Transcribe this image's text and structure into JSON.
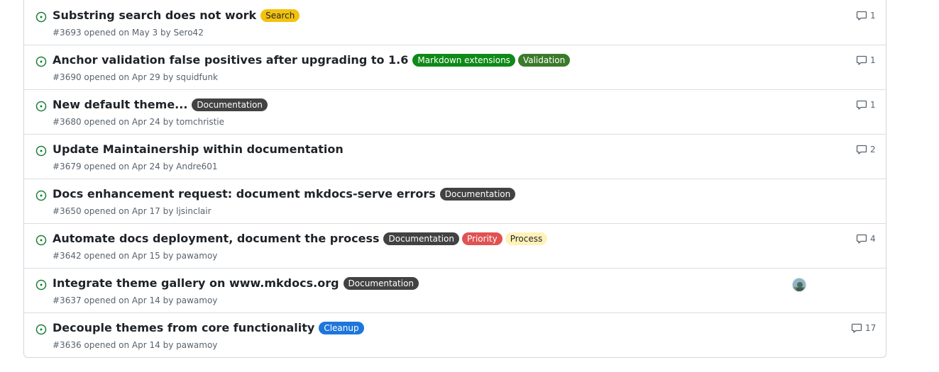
{
  "issues": [
    {
      "title": "Substring search does not work",
      "meta_prefix": "#3693 opened on May 3 by ",
      "author": "Sero42",
      "labels": [
        {
          "text": "Search",
          "bg": "#f4c20d",
          "fg": "#1f2328"
        }
      ],
      "comments": "1"
    },
    {
      "title": "Anchor validation false positives after upgrading to 1.6",
      "meta_prefix": "#3690 opened on Apr 29 by ",
      "author": "squidfunk",
      "labels": [
        {
          "text": "Markdown extensions",
          "bg": "#0e8a16",
          "fg": "#ffffff"
        },
        {
          "text": "Validation",
          "bg": "#3b7a2a",
          "fg": "#ffffff"
        }
      ],
      "comments": "1"
    },
    {
      "title": "New default theme...",
      "meta_prefix": "#3680 opened on Apr 24 by ",
      "author": "tomchristie",
      "labels": [
        {
          "text": "Documentation",
          "bg": "#424242",
          "fg": "#ffffff"
        }
      ],
      "comments": "1"
    },
    {
      "title": "Update Maintainership within documentation",
      "meta_prefix": "#3679 opened on Apr 24 by ",
      "author": "Andre601",
      "labels": [],
      "comments": "2"
    },
    {
      "title": "Docs enhancement request: document mkdocs-serve errors",
      "meta_prefix": "#3650 opened on Apr 17 by ",
      "author": "ljsinclair",
      "labels": [
        {
          "text": "Documentation",
          "bg": "#424242",
          "fg": "#ffffff"
        }
      ],
      "comments": ""
    },
    {
      "title": "Automate docs deployment, document the process",
      "meta_prefix": "#3642 opened on Apr 15 by ",
      "author": "pawamoy",
      "labels": [
        {
          "text": "Documentation",
          "bg": "#424242",
          "fg": "#ffffff"
        },
        {
          "text": "Priority",
          "bg": "#e05252",
          "fg": "#ffffff"
        },
        {
          "text": "Process",
          "bg": "#fff2b8",
          "fg": "#1f2328"
        }
      ],
      "comments": "4"
    },
    {
      "title": "Integrate theme gallery on www.mkdocs.org",
      "meta_prefix": "#3637 opened on Apr 14 by ",
      "author": "pawamoy",
      "labels": [
        {
          "text": "Documentation",
          "bg": "#424242",
          "fg": "#ffffff"
        }
      ],
      "comments": "",
      "has_assignee": true
    },
    {
      "title": "Decouple themes from core functionality",
      "meta_prefix": "#3636 opened on Apr 14 by ",
      "author": "pawamoy",
      "labels": [
        {
          "text": "Cleanup",
          "bg": "#1d76db",
          "fg": "#ffffff"
        }
      ],
      "comments": "17"
    }
  ],
  "colors": {
    "open_icon": "#1a7f37",
    "meta_text": "#59636e",
    "border": "#d0d7de"
  },
  "icons": {
    "status": "issue-opened-icon",
    "comments": "comment-icon",
    "assignee": "avatar"
  }
}
